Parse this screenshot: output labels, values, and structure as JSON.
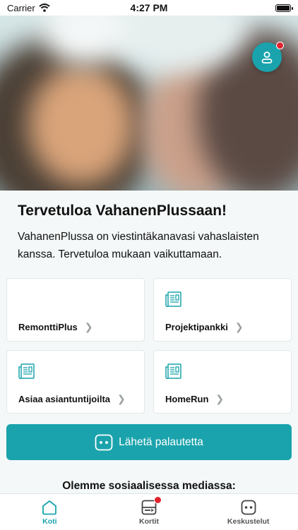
{
  "status_bar": {
    "carrier": "Carrier",
    "time": "4:27 PM"
  },
  "welcome": {
    "title": "Tervetuloa VahanenPlussaan!",
    "body": "VahanenPlussa on viestintäkanavasi vahaslaisten kanssa. Tervetuloa mukaan vaikuttamaan."
  },
  "cards": [
    {
      "label": "RemonttiPlus",
      "icon": "none"
    },
    {
      "label": "Projektipankki",
      "icon": "newspaper-icon"
    },
    {
      "label": "Asiaa asiantuntijoilta",
      "icon": "newspaper-icon"
    },
    {
      "label": "HomeRun",
      "icon": "newspaper-icon"
    }
  ],
  "feedback_button": {
    "label": "Lähetä palautetta"
  },
  "social": {
    "title": "Olemme sosiaalisessa mediassa:"
  },
  "tabbar": {
    "tabs": [
      {
        "label": "Koti",
        "icon": "home-icon",
        "active": true
      },
      {
        "label": "Kortit",
        "icon": "cards-icon",
        "active": false,
        "badge": true
      },
      {
        "label": "Keskustelut",
        "icon": "chat-icon",
        "active": false
      }
    ]
  },
  "colors": {
    "accent": "#1aa3ac",
    "badge": "#e0232e"
  }
}
